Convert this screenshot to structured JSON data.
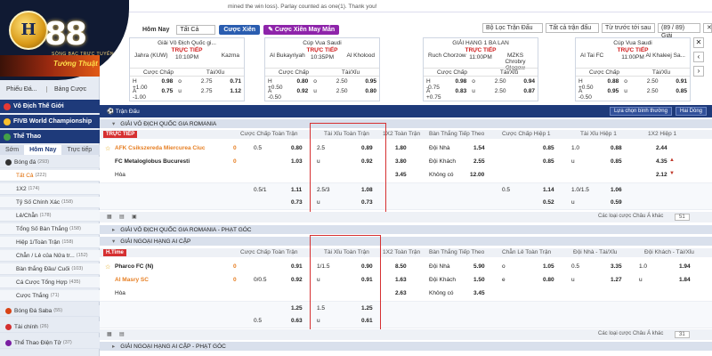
{
  "brand": {
    "name": "88",
    "monogram": "H",
    "slogan": "SÒNG BẠC TRỰC TUYẾN",
    "promo": "Tướng Thuật"
  },
  "top": {
    "notice": "mined the win loss). Parlay counted as one(1). Thank you!"
  },
  "filter": {
    "day": "Hôm Nay",
    "scope": "Tất Cả",
    "btn_parlay": "Cược Xiên",
    "btn_lucky": "Cược Xiên May Mắn",
    "league_filter": "Bộ Lọc Trận Đấu",
    "all_matches": "Tất cả trận đấu",
    "sort": "Từ trước tới sau",
    "count": "(89 / 89) Giải",
    "colors": {
      "parlay": "#2a5db0",
      "lucky": "#8e24aa"
    }
  },
  "sidebar": {
    "lang": "Phiếu Đá...",
    "bets": "Bảng Cược",
    "sections": [
      {
        "label": "Vô Địch Thế Giới",
        "color": "#e53935"
      },
      {
        "label": "FIVB World Championship",
        "color": "#fbc02d"
      },
      {
        "label": "Thể Thao",
        "color": "#43a047"
      }
    ],
    "tabs": [
      "Sớm",
      "Hôm Nay",
      "Trực tiếp"
    ],
    "items": [
      {
        "label": "Bóng đá",
        "count": "(293)",
        "type": "cat"
      },
      {
        "label": "Tất Cả",
        "count": "(222)",
        "type": "sel"
      },
      {
        "label": "1X2",
        "count": "(174)"
      },
      {
        "label": "Tỷ Số Chính Xác",
        "count": "(158)"
      },
      {
        "label": "Lẻ/Chẵn",
        "count": "(178)"
      },
      {
        "label": "Tổng Số Bàn Thắng",
        "count": "(158)"
      },
      {
        "label": "Hiệp 1/Toàn Trận",
        "count": "(158)"
      },
      {
        "label": "Chẵn / Lẻ của Nửa tr...",
        "count": "(152)"
      },
      {
        "label": "Bàn thắng Đầu/ Cuối",
        "count": "(103)"
      },
      {
        "label": "Cá Cược Tổng Hợp",
        "count": "(435)"
      },
      {
        "label": "Cược Thắng",
        "count": "(71)"
      },
      {
        "label": "Bóng Đá Saba",
        "count": "(55)",
        "type": "cat"
      },
      {
        "label": "Tài chính",
        "count": "(26)",
        "type": "cat"
      },
      {
        "label": "Thể Thao Điện Tử",
        "count": "(37)",
        "type": "cat"
      }
    ]
  },
  "cards": [
    {
      "league": "Giải Vô Địch Quốc gi...",
      "home": "Jahra (KUW)",
      "away": "Kazma",
      "live": "TRỰC TIẾP",
      "time": "10:10PM",
      "h1": "0.98",
      "h2": "0.75",
      "ou1": "2.75",
      "ou2": "2.75",
      "o1": "0.71",
      "o2": "1.12",
      "hcp1": "H +1.00",
      "hcp2": "A -1.00",
      "ou1l": "o",
      "ou2l": "u"
    },
    {
      "league": "Cúp Vua Saudi",
      "home": "Al Bukayriyah",
      "away": "Al Kholood",
      "live": "TRỰC TIẾP",
      "time": "10:35PM",
      "h1": "0.80",
      "h2": "0.92",
      "ou1": "2.50",
      "ou2": "2.50",
      "o1": "0.95",
      "o2": "0.80",
      "hcp1": "H +0.50",
      "hcp2": "A -0.50",
      "ou1l": "o",
      "ou2l": "u"
    },
    {
      "league": "GIẢI HẠNG 1 BA LAN",
      "home": "Ruch Chorzow",
      "away": "MZKS Chrobry Glogow",
      "live": "TRỰC TIẾP",
      "time": "11:00PM",
      "h1": "0.98",
      "h2": "0.83",
      "ou1": "2.50",
      "ou2": "2.50",
      "o1": "0.94",
      "o2": "0.87",
      "hcp1": "H -0.75",
      "hcp2": "A +0.75",
      "ou1l": "o",
      "ou2l": "u"
    },
    {
      "league": "Cúp Vua Saudi",
      "home": "Al Tai FC",
      "away": "Al Khaleej Sa...",
      "live": "TRỰC TIẾP",
      "time": "11:00PM",
      "h1": "0.88",
      "h2": "0.95",
      "ou1": "2.50",
      "ou2": "2.50",
      "o1": "0.91",
      "o2": "0.85",
      "hcp1": "H +0.50",
      "hcp2": "A -0.50",
      "ou1l": "o",
      "ou2l": "u"
    }
  ],
  "cardCols": {
    "hcp": "Cược Chấp",
    "ou": "Tài/Xỉu"
  },
  "main": {
    "title": "Trận Đấu",
    "opt1": "Lựa chọn bình thường",
    "opt2": "Hai Dòng",
    "cols": {
      "hcp": "Cược Chấp Toàn Trận",
      "ou": "Tài Xỉu Toàn Trận",
      "x12": "1X2 Toàn Trận",
      "next": "Bàn Thắng Tiếp Theo",
      "hcp1": "Cược Chấp Hiệp 1",
      "ou1": "Tài Xỉu Hiệp 1",
      "x121": "1X2 Hiệp 1",
      "oe": "Chẵn Lẻ Toàn Trận",
      "hou": "Đội Nhà - Tài/Xỉu",
      "aou": "Đội Khách - Tài/Xỉu"
    },
    "odds_type": "Các loại cược Châu Á khác",
    "page": "51",
    "page2": "31"
  },
  "leagues": [
    {
      "name": "GIẢI VÔ ĐỊCH QUỐC GIA ROMANIA"
    },
    {
      "name": "GIẢI VÔ ĐỊCH QUỐC GIA ROMANIA - PHẠT GÓC"
    },
    {
      "name": "GIẢI NGOẠI HẠNG AI CẬP"
    },
    {
      "name": "GIẢI NGOẠI HẠNG AI CẬP - PHẠT GÓC"
    }
  ],
  "m1": {
    "status": "TRỰC TIẾP",
    "home": "AFK Csikszereda Miercurea Ciuc",
    "away": "FC Metaloglobus Bucuresti",
    "draw": "Hòa",
    "score_h": "0",
    "score_a": "0",
    "r1": {
      "hcp": "0.5",
      "hcp_o": "0.80",
      "ou": "2.5",
      "ou_o": "0.89",
      "x": "1.80",
      "nl": "Đội Nhà",
      "nv": "1.54",
      "h1c": "0.85",
      "ou1": "1.0",
      "ou1o": "0.88",
      "x1": "2.44"
    },
    "r2": {
      "hcp_o": "1.03",
      "ou": "u",
      "ou_o": "0.92",
      "x": "3.80",
      "nl": "Đội Khách",
      "nv": "2.55",
      "h1c": "0.85",
      "ou1": "u",
      "ou1o": "0.85",
      "x1": "4.35"
    },
    "r3": {
      "x": "3.45",
      "nl": "Không có",
      "nv": "12.00",
      "x1": "2.12"
    },
    "r4": {
      "hcp": "0.5/1",
      "hcp_o": "1.11",
      "ou": "2.5/3",
      "ou_o": "1.08",
      "h1": "0.5",
      "h1o": "1.14",
      "ou1": "1.0/1.5",
      "ou1o": "1.06"
    },
    "r5": {
      "hcp_o": "0.73",
      "ou": "u",
      "ou_o": "0.73",
      "h1o": "0.52",
      "ou1": "u",
      "ou1o": "0.59"
    }
  },
  "m2": {
    "status": "H.Time",
    "home": "Pharco FC (N)",
    "away": "Al Masry SC",
    "draw": "Hòa",
    "score_h": "0",
    "score_a": "0",
    "r1": {
      "hcp_o": "0.91",
      "ou": "1/1.5",
      "ou_o": "0.90",
      "x": "8.50",
      "nl": "Đội Nhà",
      "nv": "5.90",
      "oe": "o",
      "oev": "1.05",
      "ho": "0.5",
      "hov": "3.35",
      "ao": "1.0",
      "aov": "1.94"
    },
    "r2": {
      "hcp": "0/0.5",
      "hcp_o": "0.92",
      "ou": "u",
      "ou_o": "0.91",
      "x": "1.63",
      "nl": "Đội Khách",
      "nv": "1.50",
      "oe": "e",
      "oev": "0.80",
      "ho": "u",
      "hov": "1.27",
      "ao": "u",
      "aov": "1.84"
    },
    "r3": {
      "x": "2.63",
      "nl": "Không có",
      "nv": "3.45"
    },
    "r4": {
      "hcp_o": "1.25",
      "ou": "1.5",
      "ou_o": "1.25"
    },
    "r5": {
      "hcp": "0.5",
      "hcp_o": "0.63",
      "ou": "u",
      "ou_o": "0.61"
    }
  }
}
